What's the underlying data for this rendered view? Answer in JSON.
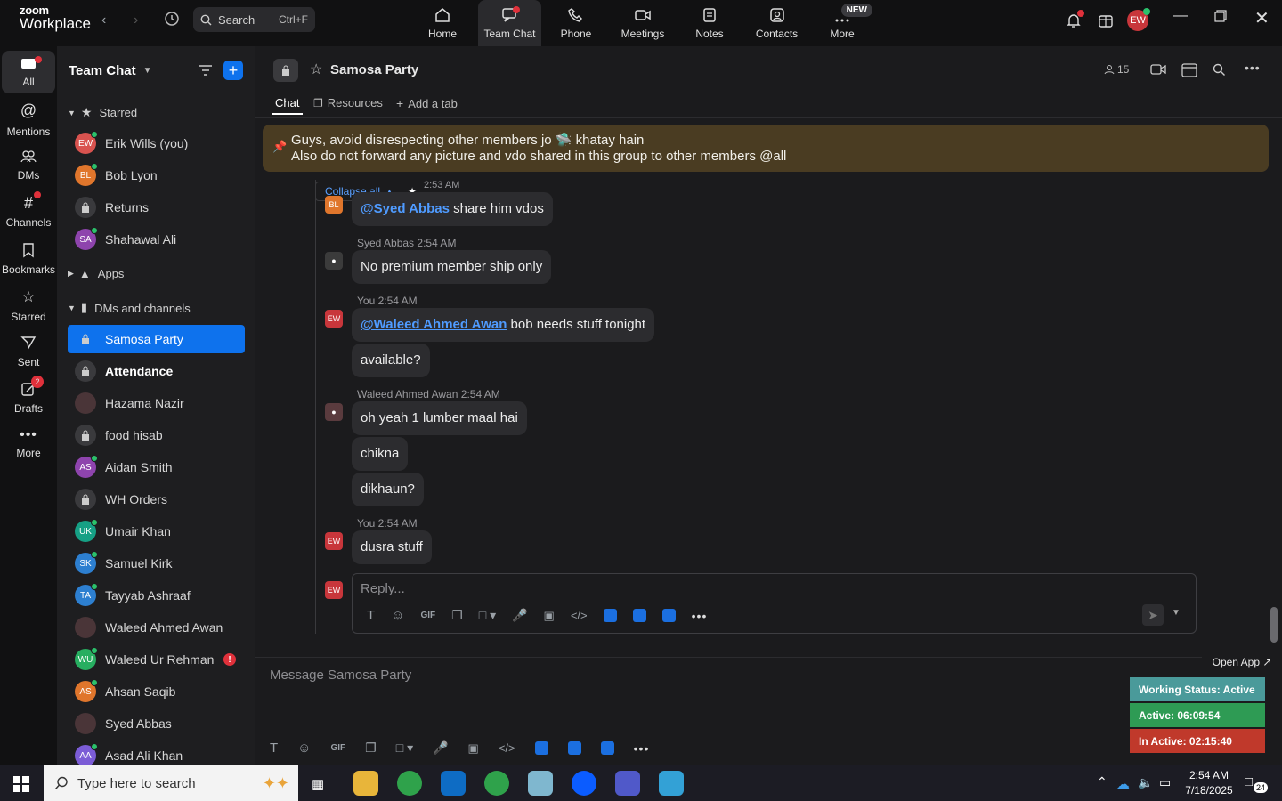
{
  "app": {
    "brand_top": "zoom",
    "brand_bottom": "Workplace"
  },
  "search": {
    "label": "Search",
    "shortcut": "Ctrl+F"
  },
  "topnav": [
    {
      "label": "Home",
      "icon": "home-icon"
    },
    {
      "label": "Team Chat",
      "icon": "chat-icon"
    },
    {
      "label": "Phone",
      "icon": "phone-icon"
    },
    {
      "label": "Meetings",
      "icon": "video-icon"
    },
    {
      "label": "Notes",
      "icon": "notes-icon"
    },
    {
      "label": "Contacts",
      "icon": "contacts-icon"
    },
    {
      "label": "More",
      "icon": "more-icon"
    }
  ],
  "topnav_new_badge": "NEW",
  "user_avatar": "EW",
  "rail": [
    {
      "label": "All"
    },
    {
      "label": "Mentions"
    },
    {
      "label": "DMs"
    },
    {
      "label": "Channels"
    },
    {
      "label": "Bookmarks"
    },
    {
      "label": "Starred"
    },
    {
      "label": "Sent"
    },
    {
      "label": "Drafts",
      "badge": "2"
    },
    {
      "label": "More"
    }
  ],
  "sidebar": {
    "title": "Team Chat",
    "sections": {
      "starred": "Starred",
      "apps": "Apps",
      "dms": "DMs and channels"
    },
    "starred": [
      {
        "name": "Erik Wills (you)",
        "initials": "EW",
        "color": "#d9534f"
      },
      {
        "name": "Bob Lyon",
        "initials": "BL",
        "color": "#e0762c"
      },
      {
        "name": "Returns",
        "initials": "",
        "color": ""
      },
      {
        "name": "Shahawal Ali",
        "initials": "SA",
        "color": "#8e44ad"
      }
    ],
    "channels": [
      {
        "name": "Samosa Party",
        "type": "lock"
      },
      {
        "name": "Attendance",
        "type": "lock"
      },
      {
        "name": "Hazama Nazir",
        "type": "photo"
      },
      {
        "name": "food hisab",
        "type": "lock"
      },
      {
        "name": "Aidan Smith",
        "initials": "AS",
        "color": "#8e44ad"
      },
      {
        "name": "WH Orders",
        "type": "lock"
      },
      {
        "name": "Umair Khan",
        "initials": "UK",
        "color": "#16a085"
      },
      {
        "name": "Samuel Kirk",
        "initials": "SK",
        "color": "#2d7fd0"
      },
      {
        "name": "Tayyab Ashraaf",
        "initials": "TA",
        "color": "#2d7fd0"
      },
      {
        "name": "Waleed Ahmed Awan",
        "type": "photo"
      },
      {
        "name": "Waleed Ur Rehman",
        "initials": "WU",
        "color": "#27ae60"
      },
      {
        "name": "Ahsan Saqib",
        "initials": "AS",
        "color": "#e0762c"
      },
      {
        "name": "Syed Abbas",
        "type": "photo"
      },
      {
        "name": "Asad Ali Khan",
        "initials": "AA",
        "color": "#7b5cd6"
      }
    ]
  },
  "channel": {
    "name": "Samosa Party",
    "members": "15",
    "tabs": [
      "Chat",
      "Resources",
      "Add a tab"
    ],
    "pinned_line1": "Guys, avoid disrespecting other members jo 🛸 khatay hain",
    "pinned_line2": "Also do not forward any picture and vdo shared in this group to other members @all",
    "collapse_all": "Collapse all",
    "partial_time": "2:53 AM"
  },
  "messages": [
    {
      "sender": "",
      "time": "",
      "mention": "@Syed Abbas",
      "text": " share him vdos"
    },
    {
      "sender": "Syed Abbas",
      "time": "2:54 AM",
      "text": "No premium member ship only"
    },
    {
      "sender": "You",
      "time": "2:54 AM",
      "mention": "@Waleed Ahmed Awan",
      "text": " bob needs stuff tonight"
    },
    {
      "text": "available?"
    },
    {
      "sender": "Waleed Ahmed Awan",
      "time": "2:54 AM",
      "text": "oh yeah 1 lumber maal hai"
    },
    {
      "text": "chikna"
    },
    {
      "text": "dikhaun?"
    },
    {
      "sender": "You",
      "time": "2:54 AM",
      "text": "dusra stuff"
    }
  ],
  "reply_placeholder": "Reply...",
  "compose_placeholder": "Message Samosa Party",
  "status_widget": {
    "open_app": "Open App ↗",
    "working": "Working Status: Active",
    "active": "Active: 06:09:54",
    "inactive": "In Active: 02:15:40"
  },
  "taskbar": {
    "search_placeholder": "Type here to search",
    "time": "2:54 AM",
    "date": "7/18/2025",
    "notif_count": "24"
  },
  "colors": {
    "accent": "#0e72ed",
    "pinned_bg": "#4a3c22",
    "working": "#4a9a9a",
    "active": "#2e9b54",
    "inactive": "#c0392b"
  }
}
